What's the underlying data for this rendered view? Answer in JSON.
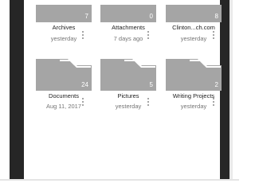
{
  "folders": [
    {
      "name": "Archives",
      "meta": "yesterday",
      "count": "7"
    },
    {
      "name": "Attachments",
      "meta": "7 days ago",
      "count": "0"
    },
    {
      "name": "Clinton...ch.com",
      "meta": "yesterday",
      "count": "8"
    },
    {
      "name": "Documents",
      "meta": "Aug 11, 2017",
      "count": "24"
    },
    {
      "name": "Pictures",
      "meta": "yesterday",
      "count": "5"
    },
    {
      "name": "Writing Projects",
      "meta": "yesterday",
      "count": "2"
    }
  ]
}
